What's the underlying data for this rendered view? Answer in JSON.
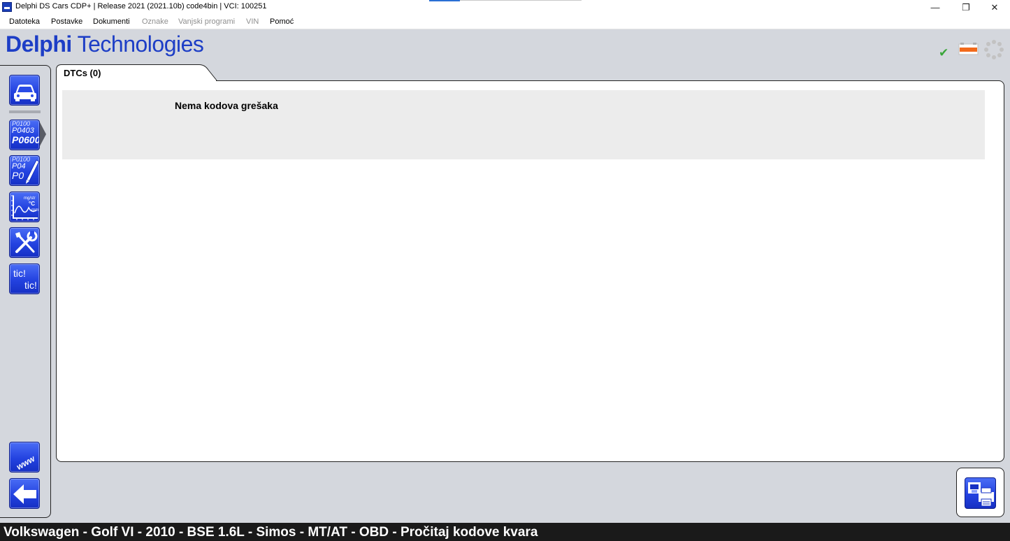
{
  "window": {
    "title": "Delphi DS Cars CDP+ | Release 2021 (2021.10b) code4bin  |  VCI: 100251",
    "controls": {
      "minimize": "—",
      "restore": "❐",
      "close": "✕"
    }
  },
  "menu": {
    "items": [
      {
        "label": "Datoteka",
        "enabled": true
      },
      {
        "label": "Postavke",
        "enabled": true
      },
      {
        "label": "Dokumenti",
        "enabled": true
      },
      {
        "label": "Oznake",
        "enabled": false
      },
      {
        "label": "Vanjski programi",
        "enabled": false
      },
      {
        "label": "VIN",
        "enabled": false
      },
      {
        "label": "Pomoć",
        "enabled": true
      }
    ]
  },
  "header": {
    "logo_bold": "Delphi",
    "logo_rest": " Technologies",
    "logo_color": "#1d3ec6",
    "status_icons": [
      "checkmark-icon",
      "battery-icon",
      "spinner-icon"
    ]
  },
  "toolbar": {
    "buttons": [
      {
        "name": "vehicle-select-button",
        "icon": "car-icon"
      },
      {
        "name": "read-dtc-button",
        "icon": "dtc-codes-icon",
        "lines": [
          "P0100",
          "P0403",
          "P0600"
        ],
        "selected": true
      },
      {
        "name": "clear-dtc-button",
        "icon": "dtc-erase-icon",
        "lines": [
          "P0100",
          "P04",
          "P0"
        ]
      },
      {
        "name": "live-data-button",
        "icon": "graph-icon",
        "labels": [
          "mg/str",
          "°C",
          "rpm"
        ]
      },
      {
        "name": "service-button",
        "icon": "tools-icon"
      },
      {
        "name": "tic-tic-button",
        "icon": "tic-tic-icon",
        "text1": "tic!",
        "text2": "tic!"
      },
      {
        "name": "www-button",
        "icon": "www-icon",
        "text": "www"
      },
      {
        "name": "back-button",
        "icon": "back-arrow-icon"
      }
    ]
  },
  "main": {
    "tab_label": "DTCs (0)",
    "message": "Nema kodova grešaka"
  },
  "bottom_right": {
    "icon": "print-save-icon"
  },
  "statusbar": {
    "text": "Volkswagen - Golf VI - 2010 - BSE 1.6L - Simos - MT/AT - OBD - Pročitaj kodove kvara"
  }
}
